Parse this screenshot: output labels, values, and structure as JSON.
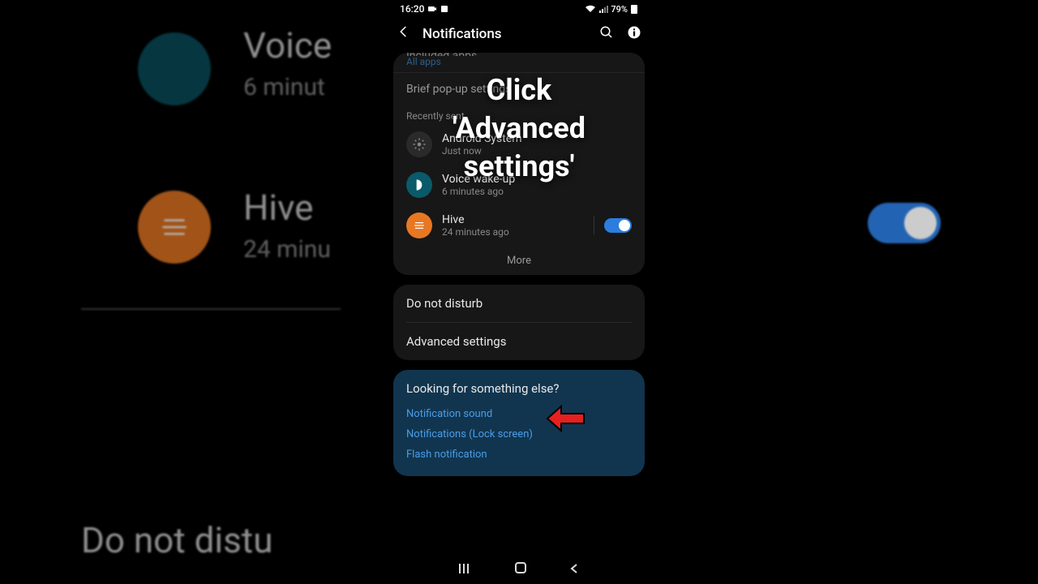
{
  "status": {
    "time": "16:20",
    "battery": "79%"
  },
  "header": {
    "title": "Notifications"
  },
  "cut_item": {
    "title": "Included apps",
    "sub": "All apps"
  },
  "brief": "Brief pop-up settings",
  "recent_label": "Recently sent",
  "apps": [
    {
      "name": "Android System",
      "time": "Just now",
      "icon": "gear"
    },
    {
      "name": "Voice wake-up",
      "time": "6 minutes ago",
      "icon": "bixby"
    },
    {
      "name": "Hive",
      "time": "24 minutes ago",
      "icon": "hive"
    }
  ],
  "more": "More",
  "menu": {
    "dnd": "Do not disturb",
    "advanced": "Advanced settings"
  },
  "suggest": {
    "title": "Looking for something else?",
    "links": [
      "Notification sound",
      "Notifications (Lock screen)",
      "Flash notification"
    ]
  },
  "overlay": {
    "line1": "Click",
    "line2": "'Advanced",
    "line3": "settings'"
  },
  "bg": {
    "voice": "Voice",
    "voice_time": "6 minut",
    "hive": "Hive",
    "hive_time": "24 minu",
    "dnd": "Do not distu"
  }
}
